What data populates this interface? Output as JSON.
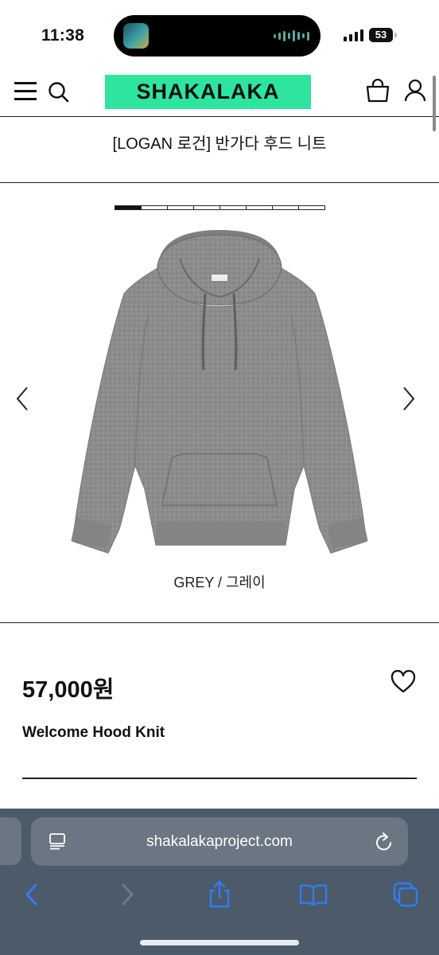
{
  "status_bar": {
    "time": "11:38",
    "battery": "53"
  },
  "header": {
    "logo": "SHAKALAKA",
    "logo_color": "#2ee5a0",
    "icons": [
      "menu-icon",
      "search-icon",
      "shopping-bag-icon",
      "user-icon"
    ]
  },
  "product": {
    "title": "[LOGAN 로건] 반가다 후드 니트",
    "gallery": {
      "total_images": 8,
      "current_index": 1,
      "color_label": "GREY / 그레이"
    },
    "price": "57,000원",
    "english_name": "Welcome Hood Knit"
  },
  "browser": {
    "url": "shakalakaproject.com",
    "accent_color": "#2f7df6",
    "toolbar": [
      "back-icon",
      "forward-icon",
      "share-icon",
      "bookmarks-icon",
      "tabs-icon"
    ]
  }
}
